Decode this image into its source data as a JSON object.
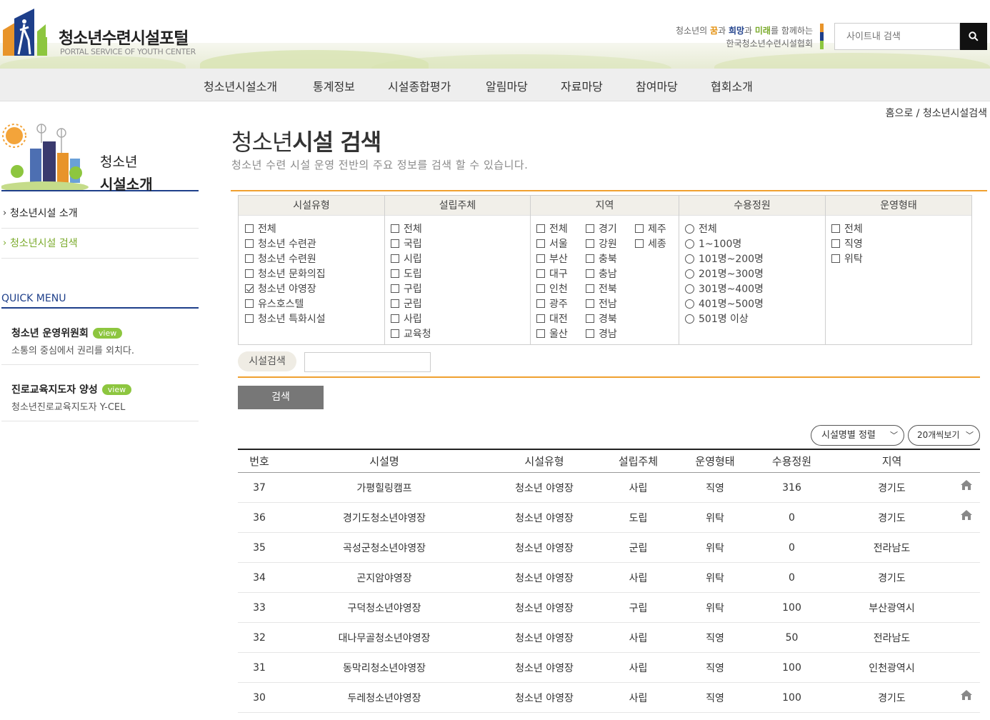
{
  "header": {
    "logo_title": "청소년수련시설포털",
    "logo_sub": "PORTAL SERVICE OF YOUTH CENTER",
    "slogan": {
      "part1": "청소년의 ",
      "w1": "꿈",
      "part2": "과 ",
      "w2": "희망",
      "part3": "과 ",
      "w3": "미래",
      "part4": "를 함께하는",
      "line2": "한국청소년수련시설협회"
    },
    "search_placeholder": "사이트내 검색"
  },
  "nav": [
    "청소년시설소개",
    "통계정보",
    "시설종합평가",
    "알림마당",
    "자료마당",
    "참여마당",
    "협회소개"
  ],
  "breadcrumb": "홈으로 / 청소년시설검색",
  "sidebar": {
    "title_line1": "청소년",
    "title_line2": "시설소개",
    "menu": [
      "청소년시설 소개",
      "청소년시설 검색"
    ],
    "quick_title": "QUICK MENU",
    "quick": [
      {
        "title": "청소년 운영위원회",
        "badge": "view",
        "desc": "소통의 중심에서 권리를 외치다."
      },
      {
        "title": "진로교육지도자 양성",
        "badge": "view",
        "desc": "청소년진로교육지도자 Y-CEL"
      }
    ]
  },
  "page": {
    "title_light": "청소년",
    "title_bold": "시설 검색",
    "desc": "청소년 수련 시설 운영 전반의 주요 정보를 검색 할 수 있습니다."
  },
  "filters": {
    "facility_type": {
      "header": "시설유형",
      "options": [
        "전체",
        "청소년 수련관",
        "청소년 수련원",
        "청소년 문화의집",
        "청소년 야영장",
        "유스호스텔",
        "청소년 특화시설"
      ],
      "checked": "청소년 야영장"
    },
    "founder": {
      "header": "설립주체",
      "options": [
        "전체",
        "국립",
        "시립",
        "도립",
        "구립",
        "군립",
        "사립",
        "교육청"
      ]
    },
    "region": {
      "header": "지역",
      "col1": [
        "전체",
        "서울",
        "부산",
        "대구",
        "인천",
        "광주",
        "대전",
        "울산"
      ],
      "col2": [
        "경기",
        "강원",
        "충북",
        "충남",
        "전북",
        "전남",
        "경북",
        "경남"
      ],
      "col3": [
        "제주",
        "세종"
      ]
    },
    "capacity": {
      "header": "수용정원",
      "options": [
        "전체",
        "1~100명",
        "101명~200명",
        "201명~300명",
        "301명~400명",
        "401명~500명",
        "501명 이상"
      ]
    },
    "operation": {
      "header": "운영형태",
      "options": [
        "전체",
        "직영",
        "위탁"
      ]
    }
  },
  "keyword": {
    "label": "시설검색",
    "value": ""
  },
  "submit_label": "검색",
  "sort_select": "시설명별 정렬",
  "page_size_select": "20개씩보기",
  "table": {
    "headers": [
      "번호",
      "시설명",
      "시설유형",
      "설립주체",
      "운영형태",
      "수용정원",
      "지역"
    ],
    "rows": [
      {
        "no": "37",
        "name": "가평힐링캠프",
        "type": "청소년 야영장",
        "founder": "사립",
        "op": "직영",
        "cap": "316",
        "region": "경기도",
        "home": true
      },
      {
        "no": "36",
        "name": "경기도청소년야영장",
        "type": "청소년 야영장",
        "founder": "도립",
        "op": "위탁",
        "cap": "0",
        "region": "경기도",
        "home": true
      },
      {
        "no": "35",
        "name": "곡성군청소년야영장",
        "type": "청소년 야영장",
        "founder": "군립",
        "op": "위탁",
        "cap": "0",
        "region": "전라남도",
        "home": false
      },
      {
        "no": "34",
        "name": "곤지암야영장",
        "type": "청소년 야영장",
        "founder": "사립",
        "op": "위탁",
        "cap": "0",
        "region": "경기도",
        "home": false
      },
      {
        "no": "33",
        "name": "구덕청소년야영장",
        "type": "청소년 야영장",
        "founder": "구립",
        "op": "위탁",
        "cap": "100",
        "region": "부산광역시",
        "home": false
      },
      {
        "no": "32",
        "name": "대나무골청소년야영장",
        "type": "청소년 야영장",
        "founder": "사립",
        "op": "직영",
        "cap": "50",
        "region": "전라남도",
        "home": false
      },
      {
        "no": "31",
        "name": "동막리청소년야영장",
        "type": "청소년 야영장",
        "founder": "사립",
        "op": "직영",
        "cap": "100",
        "region": "인천광역시",
        "home": false
      },
      {
        "no": "30",
        "name": "두레청소년야영장",
        "type": "청소년 야영장",
        "founder": "사립",
        "op": "직영",
        "cap": "100",
        "region": "경기도",
        "home": true
      }
    ]
  },
  "colors": {
    "accent_orange": "#f0a030",
    "navy": "#1e3f8a",
    "green": "#8dc63f"
  }
}
